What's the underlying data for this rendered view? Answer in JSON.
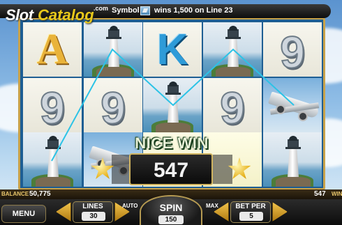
{
  "logo": {
    "part1": "Slot",
    "part2": "Catalog",
    "suffix": ".com"
  },
  "message": {
    "symbol_label": "Symbol",
    "rest": "wins 1,500 on Line 23",
    "icon": "plane-symbol-icon"
  },
  "reels": [
    [
      "A",
      "lighthouse",
      "K",
      "lighthouse",
      "9"
    ],
    [
      "9",
      "9",
      "lighthouse",
      "9",
      "plane"
    ],
    [
      "lighthouse",
      "plane",
      "wild",
      "wild",
      "lighthouse"
    ]
  ],
  "win": {
    "title": "NICE WIN",
    "amount": "547"
  },
  "info": {
    "balance_label": "BALANCE",
    "balance": "50,775",
    "win_value": "547",
    "win_label": "WIN"
  },
  "controls": {
    "menu": "MENU",
    "lines_label": "LINES",
    "lines": "30",
    "auto": "AUTO",
    "spin": "SPIN",
    "bet_total": "150",
    "max": "MAX",
    "bet_per_label": "BET PER",
    "bet_per": "5"
  },
  "colors": {
    "gold": "#d0b460",
    "win_line": "#2cc3e6",
    "reel_bg": "#1e5e93"
  }
}
